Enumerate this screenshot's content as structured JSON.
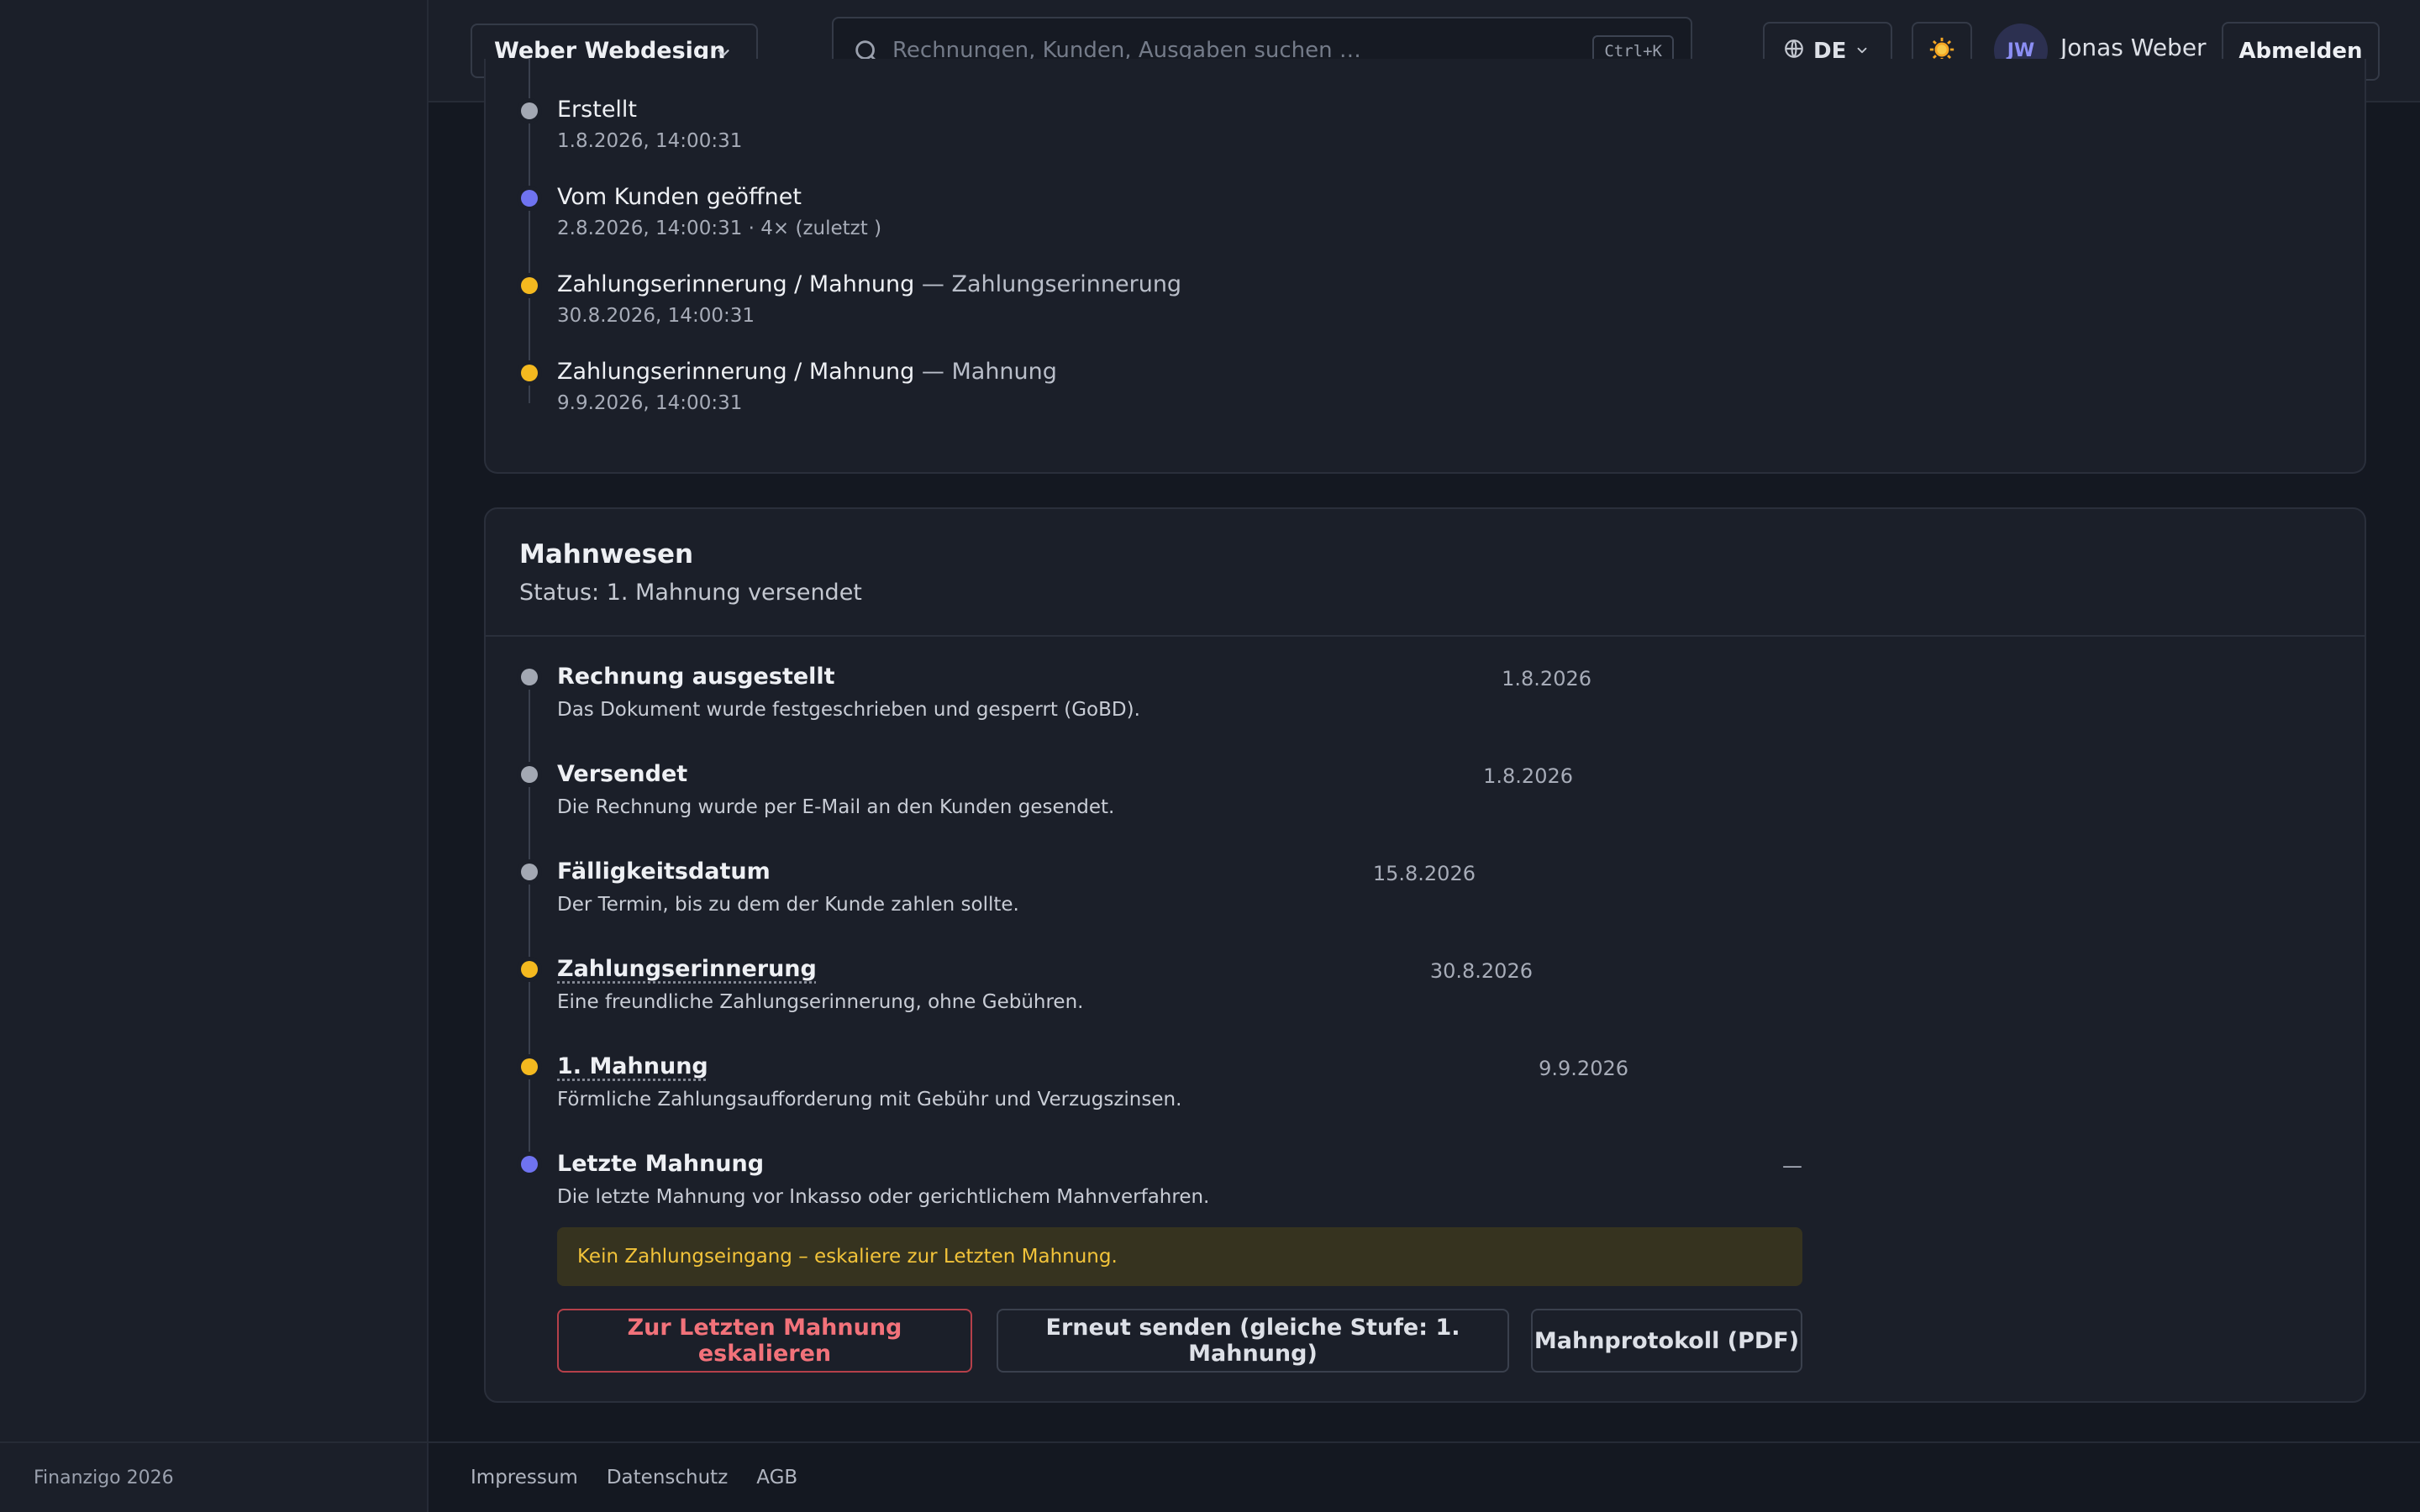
{
  "header": {
    "company": "Weber Webdesign",
    "search_placeholder": "Rechnungen, Kunden, Ausgaben suchen …",
    "search_shortcut": "Ctrl+K",
    "language": "DE",
    "user_initials": "JW",
    "user_name": "Jonas Weber",
    "logout_label": "Abmelden"
  },
  "history": [
    {
      "title": "Erstellt",
      "suffix": "",
      "time": "1.8.2026, 14:00:31",
      "status": "grey"
    },
    {
      "title": "Vom Kunden geöffnet",
      "suffix": "",
      "time": "2.8.2026, 14:00:31 · 4× (zuletzt )",
      "status": "blue"
    },
    {
      "title": "Zahlungserinnerung / Mahnung",
      "suffix": "— Zahlungserinnerung",
      "time": "30.8.2026, 14:00:31",
      "status": "yellow"
    },
    {
      "title": "Zahlungserinnerung / Mahnung",
      "suffix": "— Mahnung",
      "time": "9.9.2026, 14:00:31",
      "status": "yellow"
    }
  ],
  "dunning": {
    "title": "Mahnwesen",
    "status": "Status: 1. Mahnung versendet",
    "steps": [
      {
        "title": "Rechnung ausgestellt",
        "date": "1.8.2026",
        "desc": "Das Dokument wurde festgeschrieben und gesperrt (GoBD).",
        "status": "grey"
      },
      {
        "title": "Versendet",
        "date": "1.8.2026",
        "desc": "Die Rechnung wurde per E-Mail an den Kunden gesendet.",
        "status": "grey"
      },
      {
        "title": "Fälligkeitsdatum",
        "date": "15.8.2026",
        "desc": "Der Termin, bis zu dem der Kunde zahlen sollte.",
        "status": "grey"
      },
      {
        "title": "Zahlungserinnerung",
        "date": "30.8.2026",
        "desc": "Eine freundliche Zahlungserinnerung, ohne Gebühren.",
        "status": "yellow"
      },
      {
        "title": "1. Mahnung",
        "date": "9.9.2026",
        "desc": "Förmliche Zahlungsaufforderung mit Gebühr und Verzugszinsen.",
        "status": "yellow"
      },
      {
        "title": "Letzte Mahnung",
        "date": "—",
        "desc": "Die letzte Mahnung vor Inkasso oder gerichtlichem Mahnverfahren.",
        "status": "blue"
      }
    ],
    "alert": "Kein Zahlungseingang – eskaliere zur Letzten Mahnung.",
    "actions": {
      "escalate": "Zur Letzten Mahnung eskalieren",
      "resend": "Erneut senden (gleiche Stufe: 1. Mahnung)",
      "protocol": "Mahnprotokoll (PDF)"
    }
  },
  "sidebar": {
    "footer": "Finanzigo 2026"
  },
  "footer": {
    "links": [
      "Impressum",
      "Datenschutz",
      "AGB"
    ]
  },
  "colors": {
    "accent": "#6f73f0",
    "warning": "#f4b91f",
    "danger": "#f2727a",
    "muted": "#a3a8b3"
  }
}
